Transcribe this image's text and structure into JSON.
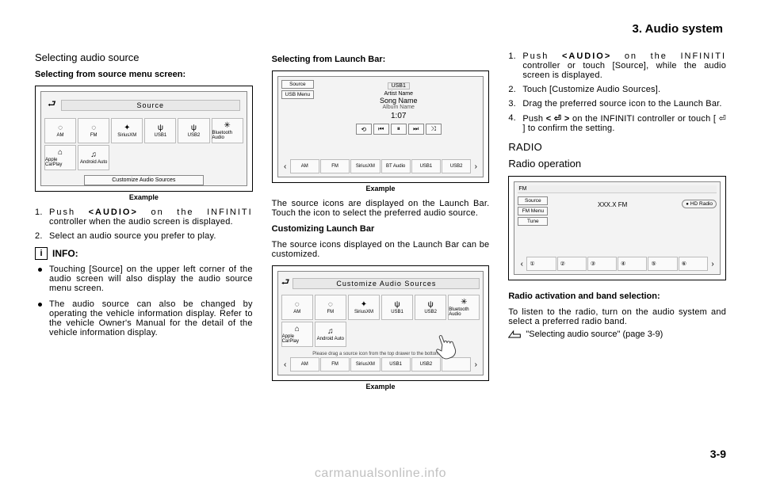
{
  "header": "3. Audio system",
  "page_num": "3-9",
  "footer_url": "carmanualsonline.info",
  "col1": {
    "title": "Selecting audio source",
    "sub1": "Selecting from source menu screen:",
    "caption1": "Example",
    "list": [
      "Push <AUDIO> on the INFINITI controller when the audio screen is displayed.",
      "Select an audio source you prefer to play."
    ],
    "info_label": "INFO:",
    "bullets": [
      "Touching [Source] on the upper left corner of the audio screen will also display the audio source menu screen.",
      "The audio source can also be changed by operating the vehicle information display. Refer to the vehicle Owner's Manual for the detail of the vehicle information display."
    ],
    "fig1": {
      "title": "Source",
      "sources_row1": [
        "AM",
        "FM",
        "SiriusXM",
        "USB1",
        "USB2",
        "Bluetooth Audio"
      ],
      "sources_row2": [
        "Apple CarPlay",
        "Android Auto"
      ],
      "customize_btn": "Customize Audio Sources"
    }
  },
  "col2": {
    "sub1": "Selecting from Launch Bar:",
    "caption1": "Example",
    "p1": "The source icons are displayed on the Launch Bar. Touch the icon to select the preferred audio source.",
    "sub2": "Customizing Launch Bar",
    "p2": "The source icons displayed on the Launch Bar can be customized.",
    "caption2": "Example",
    "fig2": {
      "title_chip": "USB1",
      "left": [
        "Source",
        "USB Menu"
      ],
      "artist": "Artist Name",
      "song": "Song Name",
      "album": "Album Name",
      "time": "1:07",
      "launch": [
        "AM",
        "FM",
        "SiriusXM",
        "BT Audio",
        "USB1",
        "USB2"
      ]
    },
    "fig3": {
      "title": "Customize Audio Sources",
      "row1": [
        "AM",
        "FM",
        "SiriusXM",
        "USB1",
        "USB2",
        "Bluetooth Audio"
      ],
      "row2": [
        "Apple CarPlay",
        "Android Auto"
      ],
      "note": "Please drag a source icon from the top drawer to the bottom bar.",
      "launch": [
        "AM",
        "FM",
        "SiriusXM",
        "USB1",
        "USB2",
        ""
      ]
    }
  },
  "col3": {
    "list": [
      "Push <AUDIO> on the INFINITI controller or touch [Source], while the audio screen is displayed.",
      "Touch [Customize Audio Sources].",
      "Drag the preferred source icon to the Launch Bar.",
      "Push < ⏎ > on the INFINITI controller or touch [ ⏎ ] to confirm the setting."
    ],
    "radio_heading": "RADIO",
    "radio_sub": "Radio operation",
    "sub1": "Radio activation and band selection:",
    "p1": "To listen to the radio, turn on the audio system and select a preferred radio band.",
    "xref": "\"Selecting audio source\" (page 3-9)",
    "fig4": {
      "band": "FM",
      "left": [
        "Source",
        "FM Menu",
        "Tune"
      ],
      "freq": "XXX.X FM",
      "hd": "HD Radio",
      "presets": [
        "①",
        "②",
        "③",
        "④",
        "⑤",
        "⑥"
      ]
    }
  }
}
